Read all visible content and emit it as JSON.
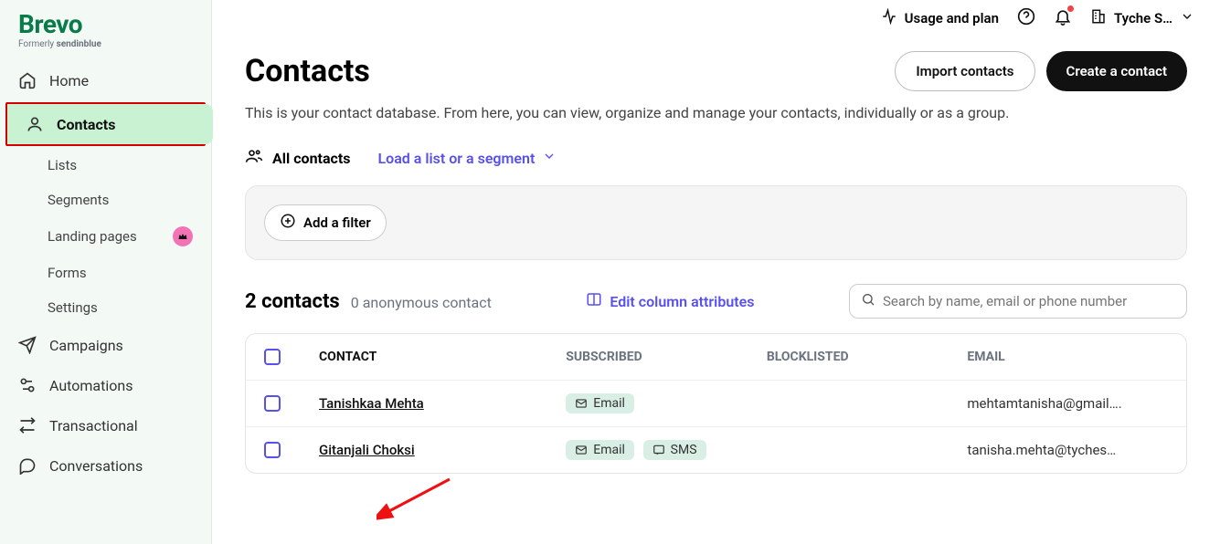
{
  "logo": {
    "text": "Brevo",
    "sub_prefix": "Formerly ",
    "sub_bold": "sendinblue"
  },
  "nav": {
    "home": "Home",
    "contacts": "Contacts",
    "sub": {
      "lists": "Lists",
      "segments": "Segments",
      "landing": "Landing pages",
      "forms": "Forms",
      "settings": "Settings"
    },
    "campaigns": "Campaigns",
    "automations": "Automations",
    "transactional": "Transactional",
    "conversations": "Conversations"
  },
  "topbar": {
    "usage": "Usage and plan",
    "account": "Tyche S…"
  },
  "page": {
    "title": "Contacts",
    "desc": "This is your contact database. From here, you can view, organize and manage your contacts, individually or as a group.",
    "import_btn": "Import contacts",
    "create_btn": "Create a contact",
    "tab_all": "All contacts",
    "tab_load": "Load a list or a segment",
    "add_filter": "Add a filter",
    "count_bold": "2 contacts",
    "count_sub": "0 anonymous contact",
    "edit_cols": "Edit column attributes",
    "search_placeholder": "Search by name, email or phone number"
  },
  "columns": {
    "contact": "CONTACT",
    "subscribed": "SUBSCRIBED",
    "blocklisted": "BLOCKLISTED",
    "email": "EMAIL"
  },
  "pills": {
    "email": "Email",
    "sms": "SMS"
  },
  "rows": [
    {
      "name": "Tanishkaa Mehta",
      "email": "mehtamtanisha@gmail….",
      "has_sms": false
    },
    {
      "name": "Gitanjali Choksi",
      "email": "tanisha.mehta@tyches…",
      "has_sms": true
    }
  ]
}
